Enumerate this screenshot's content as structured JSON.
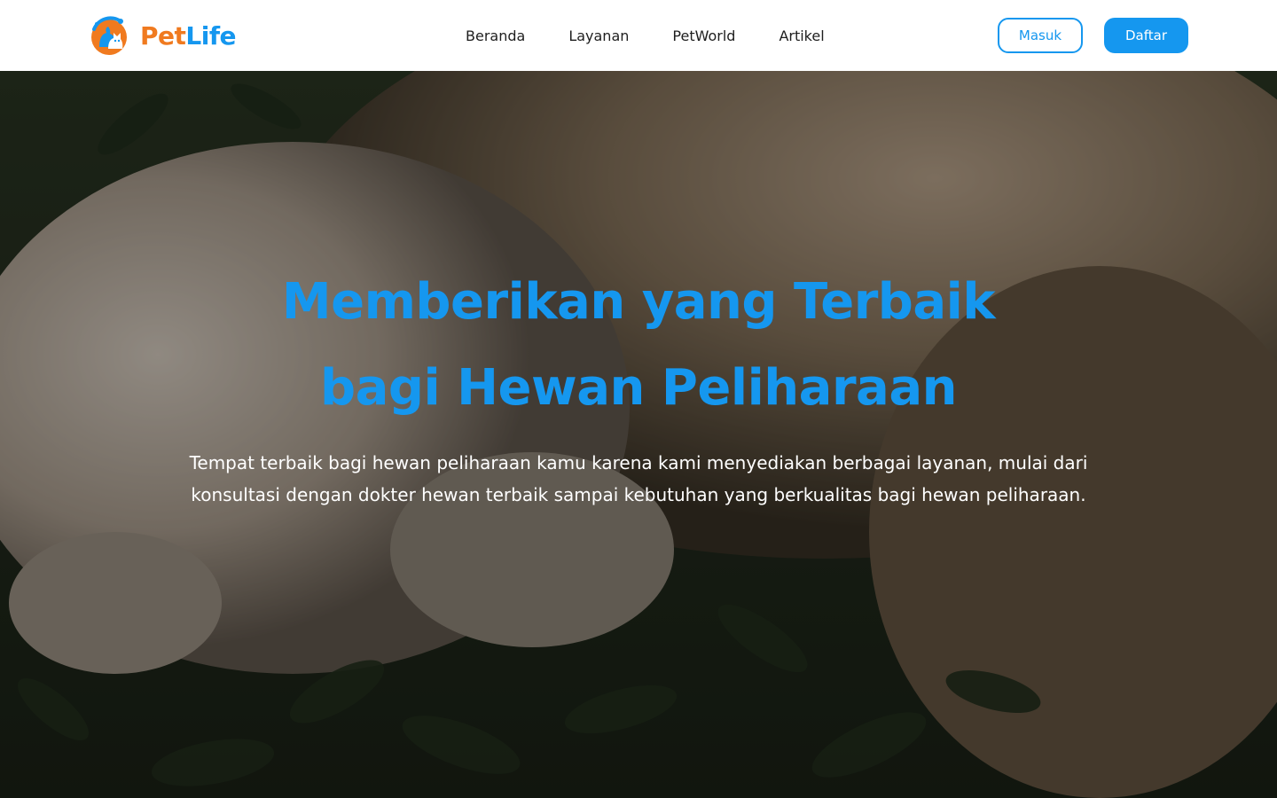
{
  "brand": {
    "name_part1": "Pet",
    "name_part2": "Life",
    "logo_icon": "pet-logo-icon",
    "color_primary": "#1597ef",
    "color_accent": "#f07a1f"
  },
  "nav": {
    "links": [
      {
        "label": "Beranda"
      },
      {
        "label": "Layanan"
      },
      {
        "label": "PetWorld"
      },
      {
        "label": "Artikel"
      }
    ],
    "login_label": "Masuk",
    "register_label": "Daftar"
  },
  "hero": {
    "title_line1": "Memberikan yang Terbaik",
    "title_line2": "bagi Hewan Peliharaan",
    "description": "Tempat terbaik bagi hewan peliharaan kamu karena kami menyediakan berbagai layanan, mulai dari konsultasi dengan dokter hewan terbaik sampai kebutuhan yang berkualitas bagi hewan peliharaan."
  }
}
